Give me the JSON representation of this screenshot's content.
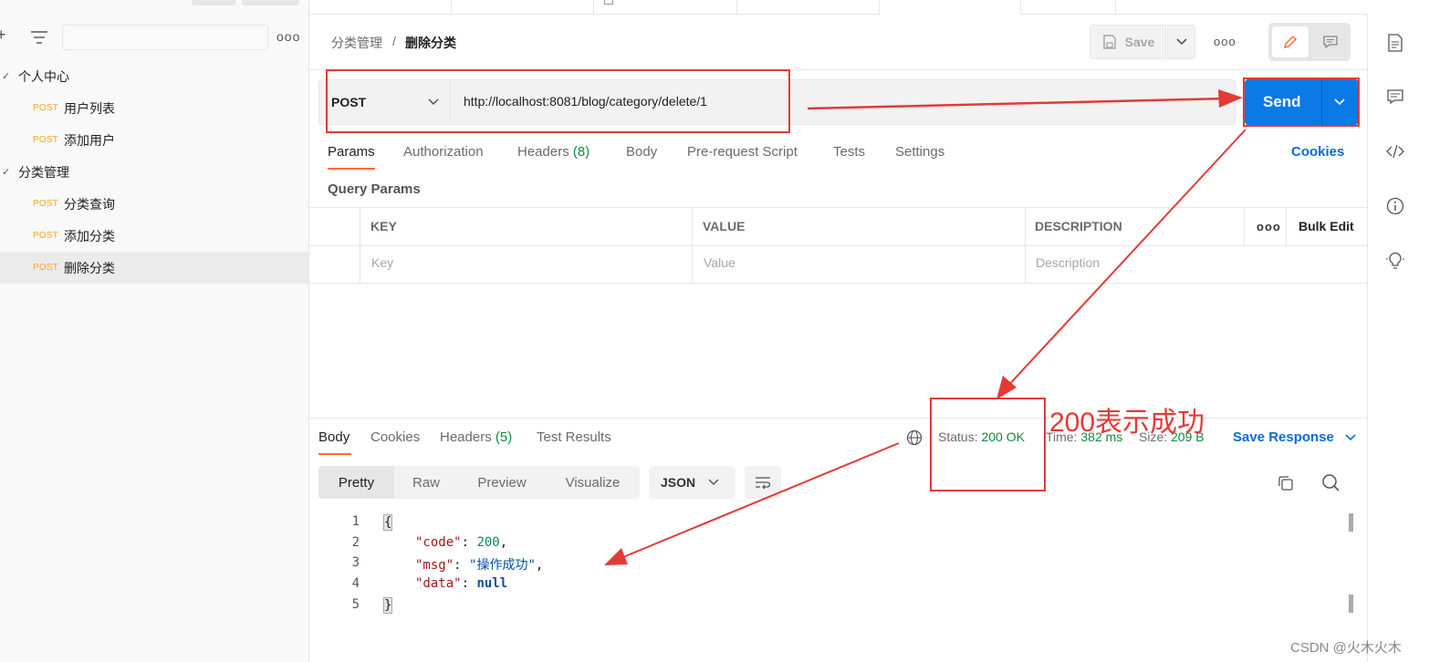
{
  "sidebar": {
    "more_icon": "more-horizontal-icon",
    "items": [
      {
        "type": "folder",
        "label": "个人中心"
      },
      {
        "type": "request",
        "method": "POST",
        "label": "用户列表"
      },
      {
        "type": "request",
        "method": "POST",
        "label": "添加用户"
      },
      {
        "type": "folder",
        "label": "分类管理"
      },
      {
        "type": "request",
        "method": "POST",
        "label": "分类查询"
      },
      {
        "type": "request",
        "method": "POST",
        "label": "添加分类"
      },
      {
        "type": "request",
        "method": "POST",
        "label": "删除分类",
        "selected": true
      }
    ]
  },
  "header": {
    "breadcrumb_parent": "分类管理",
    "breadcrumb_sep": "/",
    "breadcrumb_current": "删除分类",
    "save_label": "Save"
  },
  "request": {
    "method": "POST",
    "url": "http://localhost:8081/blog/category/delete/1",
    "send_label": "Send",
    "tabs": {
      "params": "Params",
      "authorization": "Authorization",
      "headers": "Headers",
      "headers_count": "(8)",
      "body": "Body",
      "prerequest": "Pre-request Script",
      "tests": "Tests",
      "settings": "Settings",
      "cookies": "Cookies"
    },
    "query_params_title": "Query Params",
    "table": {
      "key_header": "KEY",
      "value_header": "VALUE",
      "description_header": "DESCRIPTION",
      "bulk_edit": "Bulk Edit",
      "key_placeholder": "Key",
      "value_placeholder": "Value",
      "description_placeholder": "Description"
    }
  },
  "response": {
    "tabs": {
      "body": "Body",
      "cookies": "Cookies",
      "headers": "Headers",
      "headers_count": "(5)",
      "test_results": "Test Results"
    },
    "status_label": "Status:",
    "status_value": "200 OK",
    "time_label": "Time:",
    "time_value": "382 ms",
    "size_label": "Size:",
    "size_value": "209 B",
    "save_response": "Save Response",
    "view_modes": [
      "Pretty",
      "Raw",
      "Preview",
      "Visualize"
    ],
    "format": "JSON",
    "code_lines": {
      "l1": "{",
      "l2_key": "\"code\"",
      "l2_val": "200",
      "l3_key": "\"msg\"",
      "l3_val": "\"操作成功\"",
      "l4_key": "\"data\"",
      "l4_val": "null",
      "l5": "}"
    },
    "line_numbers": [
      "1",
      "2",
      "3",
      "4",
      "5"
    ]
  },
  "annotation": {
    "text": "200表示成功",
    "color": "#e53935"
  },
  "watermark": "CSDN @火木火木",
  "colors": {
    "accent": "#ff6c37",
    "send_blue": "#0b79e6",
    "method_orange": "#f5a623",
    "status_green": "#0f8a3d",
    "annotation_red": "#e53935"
  }
}
